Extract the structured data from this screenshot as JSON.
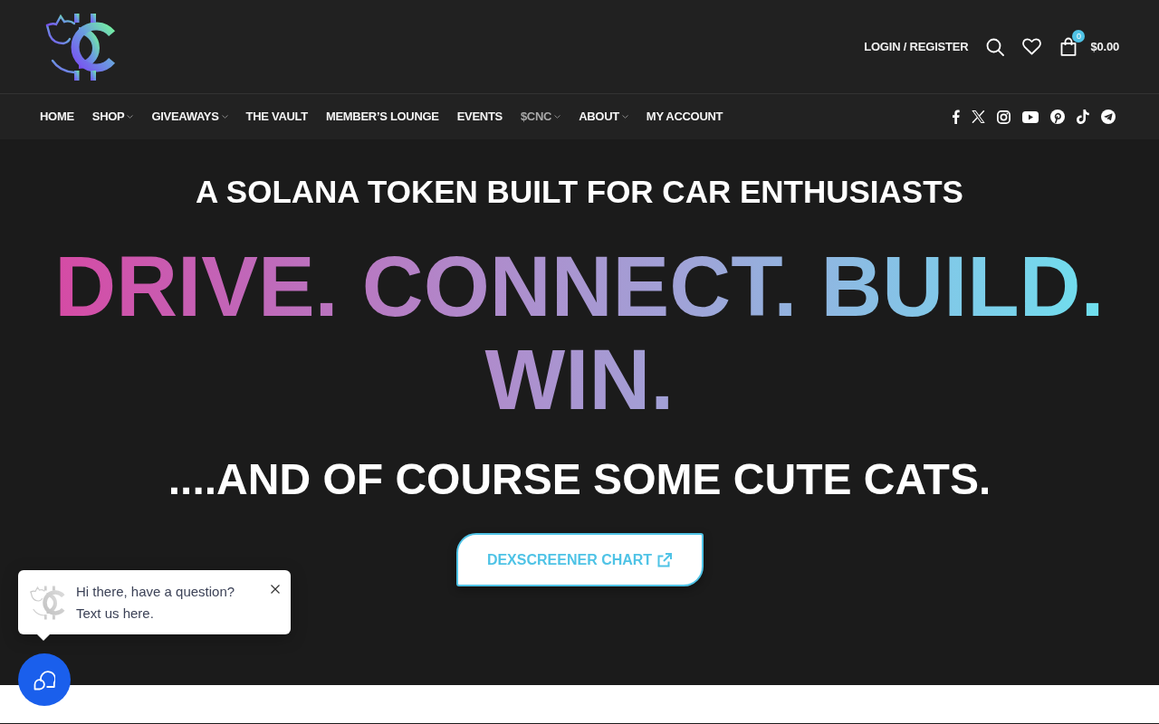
{
  "header": {
    "account_link": "LOGIN / REGISTER",
    "cart": {
      "count": "0",
      "total": "$0.00"
    }
  },
  "nav": {
    "items": [
      {
        "label": "HOME",
        "has_dropdown": false,
        "selected": false
      },
      {
        "label": "SHOP",
        "has_dropdown": true,
        "selected": false
      },
      {
        "label": "GIVEAWAYS",
        "has_dropdown": true,
        "selected": false
      },
      {
        "label": "THE VAULT",
        "has_dropdown": false,
        "selected": false
      },
      {
        "label": "MEMBER’S LOUNGE",
        "has_dropdown": false,
        "selected": false
      },
      {
        "label": "EVENTS",
        "has_dropdown": false,
        "selected": false
      },
      {
        "label": "$CNC",
        "has_dropdown": true,
        "selected": true
      },
      {
        "label": "ABOUT",
        "has_dropdown": true,
        "selected": false
      },
      {
        "label": "MY ACCOUNT",
        "has_dropdown": false,
        "selected": false
      }
    ]
  },
  "hero": {
    "tagline": "A SOLANA TOKEN BUILT FOR CAR ENTHUSIASTS",
    "headline": "DRIVE. CONNECT. BUILD. WIN.",
    "subheadline": "....AND OF COURSE SOME CUTE CATS.",
    "cta_button": "DEXSCREENER CHART"
  },
  "chat_widget": {
    "message": "Hi there, have a question? Text us here."
  }
}
